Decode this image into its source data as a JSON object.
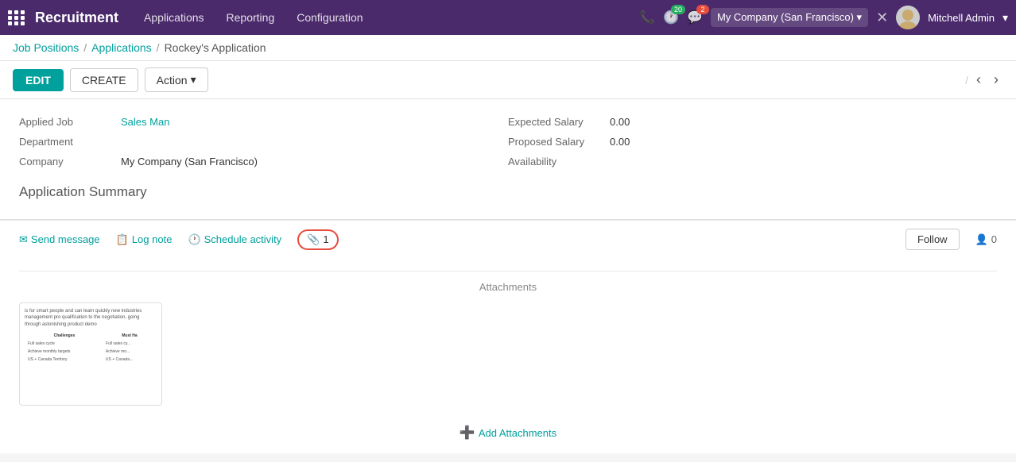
{
  "app": {
    "name": "Recruitment"
  },
  "topnav": {
    "menu_items": [
      "Applications",
      "Reporting",
      "Configuration"
    ],
    "badge_clock": "20",
    "badge_chat": "2",
    "company": "My Company (San Francisco)",
    "user": "Mitchell Admin"
  },
  "breadcrumb": {
    "job_positions": "Job Positions",
    "applications": "Applications",
    "current": "Rockey's Application"
  },
  "toolbar": {
    "edit_label": "EDIT",
    "create_label": "CREATE",
    "action_label": "Action"
  },
  "nav": {
    "slash": "/"
  },
  "form": {
    "applied_job_label": "Applied Job",
    "applied_job_value": "Sales Man",
    "department_label": "Department",
    "department_value": "",
    "company_label": "Company",
    "company_value": "My Company (San Francisco)",
    "expected_salary_label": "Expected Salary",
    "expected_salary_value": "0.00",
    "proposed_salary_label": "Proposed Salary",
    "proposed_salary_value": "0.00",
    "availability_label": "Availability",
    "availability_value": "",
    "application_summary_title": "Application Summary"
  },
  "chatter": {
    "send_message": "Send message",
    "log_note": "Log note",
    "schedule_activity": "Schedule activity",
    "activity_count": "1",
    "follow": "Follow",
    "follower_count": "0"
  },
  "attachments": {
    "title": "Attachments",
    "add_button": "Add Attachments",
    "thumb_lines": [
      "is for smart people and can learn quickly new industries management pro",
      "qualification to the negotiation, going through astonishing product demo"
    ],
    "thumb_headers": [
      "Challenges",
      "Must Ha"
    ],
    "thumb_rows": [
      [
        "Full sales cycle",
        "Full sales cy..."
      ],
      [
        "Achieve monthly targets",
        "Achieve mo..."
      ],
      [
        "US + Canada Territory",
        "US + Canada..."
      ]
    ]
  }
}
